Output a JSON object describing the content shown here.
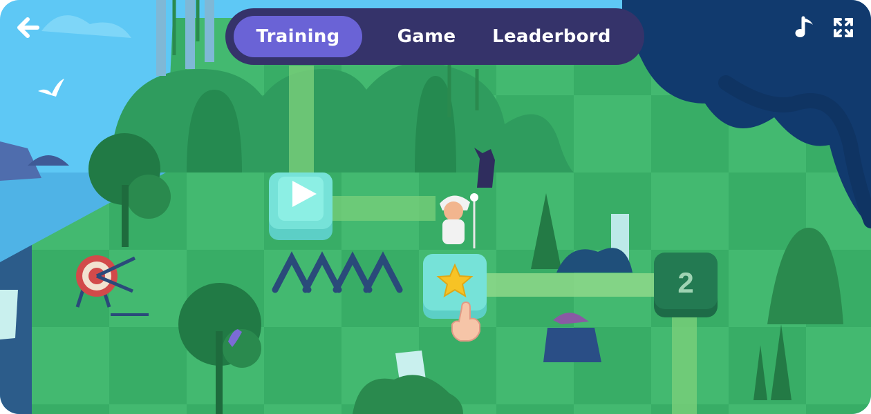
{
  "nav": {
    "tabs": [
      {
        "label": "Training",
        "active": true
      },
      {
        "label": "Game",
        "active": false
      },
      {
        "label": "Leaderbord",
        "active": false
      }
    ]
  },
  "hud": {
    "back_icon": "arrow-left-icon",
    "music_icon": "music-note-icon",
    "fullscreen_icon": "expand-icon"
  },
  "map": {
    "nodes": [
      {
        "type": "play",
        "icon": "play-icon",
        "state": "completed"
      },
      {
        "type": "star",
        "icon": "star-icon",
        "state": "current"
      },
      {
        "type": "level",
        "label": "2",
        "state": "locked"
      }
    ]
  },
  "colors": {
    "nav_bg": "#35336a",
    "nav_active": "#6a63d6",
    "grass_light": "#3bb36a",
    "grass_dark": "#2fa25c",
    "node_teal": "#76e2d8",
    "node_locked": "#237a52",
    "sky": "#5ec8f5"
  }
}
